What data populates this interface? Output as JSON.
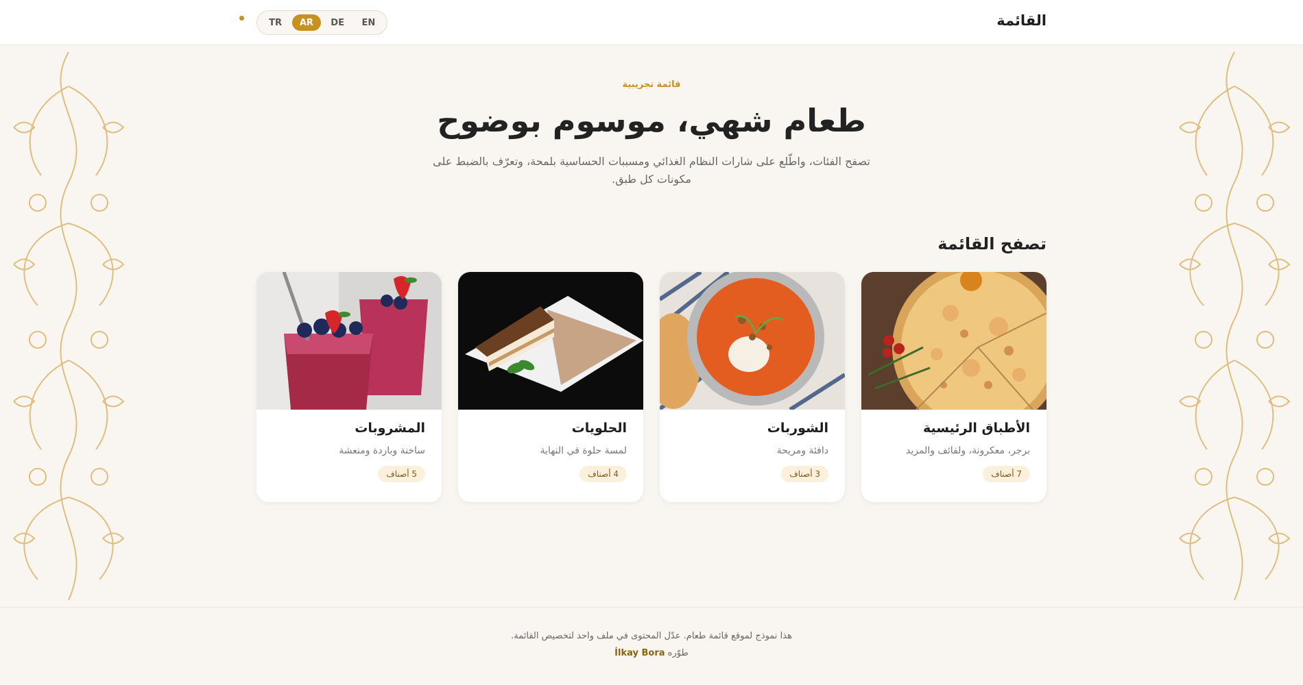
{
  "header": {
    "brand": "القائمة",
    "languages": [
      {
        "code": "TR",
        "active": false
      },
      {
        "code": "AR",
        "active": true
      },
      {
        "code": "DE",
        "active": false
      },
      {
        "code": "EN",
        "active": false
      }
    ],
    "accent": "#c8901f"
  },
  "hero": {
    "eyebrow": "قائمة تجريبية",
    "title": "طعام شهي، موسوم بوضوح",
    "description": "تصفح الفئات، واطّلع على شارات النظام الغذائي ومسببات الحساسية بلمحة، وتعرّف بالضبط على مكونات كل طبق."
  },
  "browse": {
    "title": "تصفح القائمة",
    "categories": [
      {
        "title": "الأطباق الرئيسية",
        "subtitle": "برجر، معكرونة، ولفائف والمزيد",
        "count": "7 أصناف",
        "image": "pizza"
      },
      {
        "title": "الشوربات",
        "subtitle": "دافئة ومريحة",
        "count": "3 أصناف",
        "image": "soup"
      },
      {
        "title": "الحلويات",
        "subtitle": "لمسة حلوة في النهاية",
        "count": "4 أصناف",
        "image": "tiramisu"
      },
      {
        "title": "المشروبات",
        "subtitle": "ساخنة وباردة ومنعشة",
        "count": "5 أصناف",
        "image": "smoothie"
      }
    ]
  },
  "footer": {
    "note": "هذا نموذج لموقع قائمة طعام. عدّل المحتوى في ملف واحد لتخصيص القائمة.",
    "credit_prefix": "طوّره",
    "credit_name": "İlkay Bora"
  }
}
